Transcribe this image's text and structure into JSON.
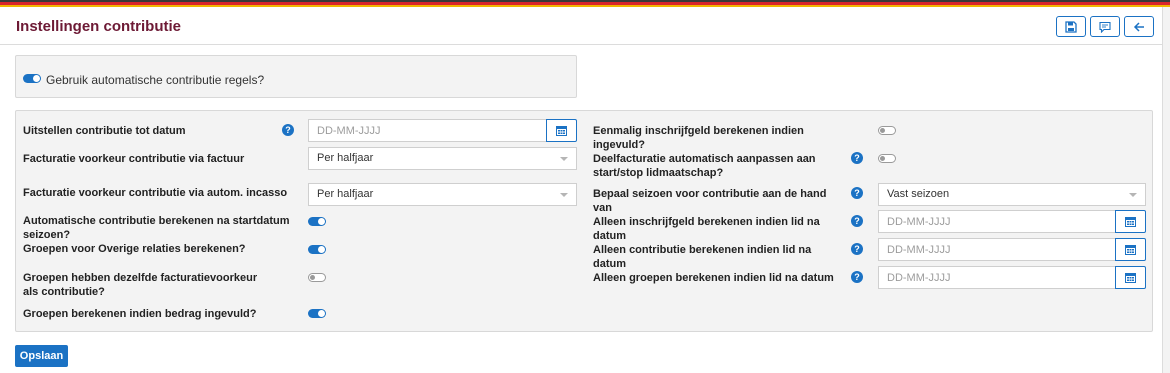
{
  "header": {
    "title": "Instellingen contributie",
    "buttons": [
      "save-icon",
      "comment-icon",
      "arrow-left-icon"
    ]
  },
  "auto_rules": {
    "label": "Gebruik automatische contributie regels?",
    "enabled": true
  },
  "left": {
    "postpone": {
      "label": "Uitstellen contributie tot datum",
      "placeholder": "DD-MM-JJJJ"
    },
    "invoice_pref": {
      "label": "Facturatie voorkeur contributie via factuur",
      "value": "Per halfjaar"
    },
    "direct_debit_pref": {
      "label": "Facturatie voorkeur contributie via autom. incasso",
      "value": "Per halfjaar"
    },
    "auto_after_start": {
      "label": "Automatische contributie berekenen na startdatum seizoen?",
      "enabled": true
    },
    "other_relations": {
      "label": "Groepen voor Overige relaties berekenen?",
      "enabled": true
    },
    "same_pref": {
      "label": "Groepen hebben dezelfde facturatievoorkeur als contributie?",
      "enabled": false
    },
    "amount_filled": {
      "label": "Groepen berekenen indien bedrag ingevuld?",
      "enabled": true
    }
  },
  "right": {
    "one_time_fee": {
      "label": "Eenmalig inschrijfgeld berekenen indien ingevuld?",
      "enabled": false
    },
    "partial_invoicing": {
      "label": "Deelfacturatie automatisch aanpassen aan start/stop lidmaatschap?",
      "enabled": false
    },
    "season": {
      "label": "Bepaal seizoen voor contributie aan de hand van",
      "value": "Vast seizoen"
    },
    "fee_after": {
      "label": "Alleen inschrijfgeld berekenen indien lid na datum",
      "placeholder": "DD-MM-JJJJ"
    },
    "contrib_after": {
      "label": "Alleen contributie berekenen indien lid na datum",
      "placeholder": "DD-MM-JJJJ"
    },
    "groups_after": {
      "label": "Alleen groepen berekenen indien lid na datum",
      "placeholder": "DD-MM-JJJJ"
    }
  },
  "help_glyph": "?",
  "save_label": "Opslaan",
  "colors": {
    "accent": "#1b72c4",
    "title": "#6d1a35",
    "panel": "#f3f3f3"
  }
}
